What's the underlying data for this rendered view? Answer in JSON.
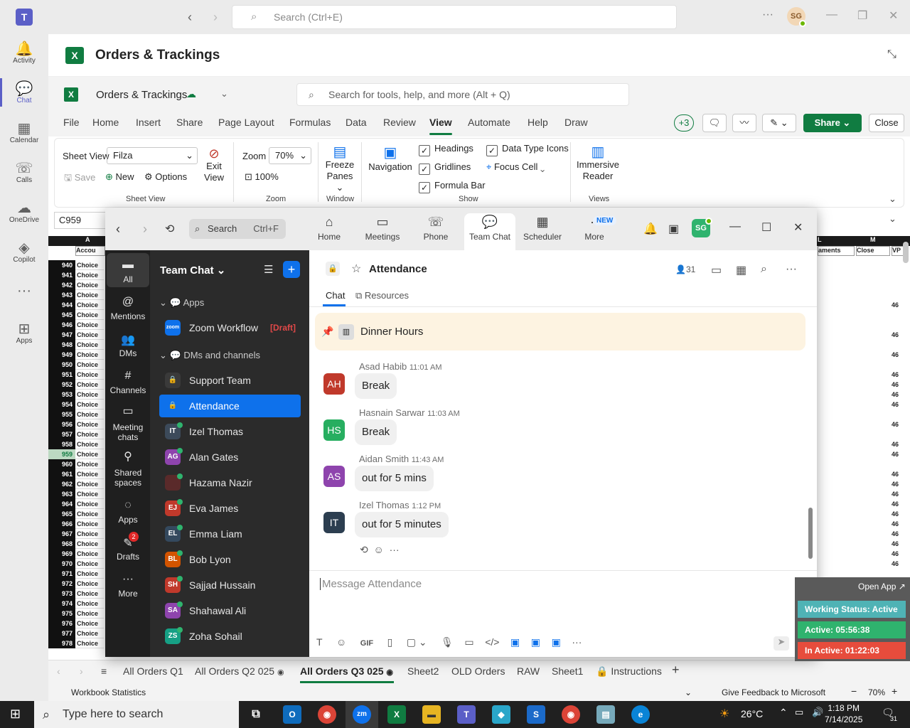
{
  "teams": {
    "search_placeholder": "Search (Ctrl+E)",
    "user_initials": "SG",
    "rail": [
      {
        "label": "Activity",
        "icon": "bell-icon"
      },
      {
        "label": "Chat",
        "icon": "chat-icon"
      },
      {
        "label": "Calendar",
        "icon": "calendar-icon"
      },
      {
        "label": "Calls",
        "icon": "phone-icon"
      },
      {
        "label": "OneDrive",
        "icon": "cloud-icon"
      },
      {
        "label": "Copilot",
        "icon": "copilot-icon"
      },
      {
        "label": "...",
        "icon": "more-icon"
      },
      {
        "label": "Apps",
        "icon": "apps-icon"
      }
    ]
  },
  "excel": {
    "header_title": "Orders & Trackings",
    "doc_name": "Orders & Trackings",
    "search_placeholder": "Search for tools, help, and more (Alt + Q)",
    "menus": [
      "File",
      "Home",
      "Insert",
      "Share",
      "Page Layout",
      "Formulas",
      "Data",
      "Review",
      "View",
      "Automate",
      "Help",
      "Draw"
    ],
    "active_menu": "View",
    "plus_count": "+3",
    "share_label": "Share",
    "close_label": "Close",
    "ribbon": {
      "sheet_view_label": "Sheet View",
      "sheet_view_value": "Filza",
      "save": "Save",
      "new": "New",
      "options": "Options",
      "exit_view": "Exit",
      "exit_view2": "View",
      "group_sheet_view": "Sheet View",
      "zoom_label": "Zoom",
      "zoom_value": "70%",
      "zoom_100": "100%",
      "group_zoom": "Zoom",
      "freeze1": "Freeze",
      "freeze2": "Panes",
      "group_window": "Window",
      "navigation": "Navigation",
      "headings": "Headings",
      "gridlines": "Gridlines",
      "formula_bar": "Formula Bar",
      "data_type_icons": "Data Type Icons",
      "focus_cell": "Focus Cell",
      "group_show": "Show",
      "immersive1": "Immersive",
      "immersive2": "Reader",
      "group_views": "Views"
    },
    "name_box": "C959",
    "col_a": "A",
    "col_l": "L",
    "col_m": "M",
    "hdr_a": "Accou",
    "hdr_l": "aments",
    "hdr_m": "Close",
    "hdr_n": "VP",
    "row_cell": "Choice",
    "rows": [
      "940",
      "941",
      "942",
      "943",
      "944",
      "945",
      "946",
      "947",
      "948",
      "949",
      "950",
      "951",
      "952",
      "953",
      "954",
      "955",
      "956",
      "957",
      "958",
      "959",
      "960",
      "961",
      "962",
      "963",
      "964",
      "965",
      "966",
      "967",
      "968",
      "969",
      "970",
      "971",
      "972",
      "973",
      "974",
      "975",
      "976",
      "977",
      "978"
    ],
    "right_val": "46",
    "sheet_tabs": [
      "All Orders Q1",
      "All Orders Q2 025",
      "All Orders Q3 025",
      "Sheet2",
      "OLD Orders",
      "RAW",
      "Sheet1",
      "Instructions"
    ],
    "status_left": "Workbook Statistics",
    "status_feedback": "Give Feedback to Microsoft",
    "status_zoom": "70%"
  },
  "zoom": {
    "search": "Search",
    "search_key": "Ctrl+F",
    "nav": [
      "Home",
      "Meetings",
      "Phone",
      "Team Chat",
      "Scheduler",
      "More"
    ],
    "new_badge": "NEW",
    "avatar": "SG",
    "rail": [
      "All",
      "Mentions",
      "DMs",
      "Channels",
      "Meeting",
      "chats",
      "Shared",
      "spaces",
      "Apps",
      "Drafts",
      "More"
    ],
    "drafts_count": "2",
    "sidebar_title": "Team Chat",
    "section_apps": "Apps",
    "zoom_workflow": "Zoom Workflow",
    "draft_tag": "[Draft]",
    "section_dms": "DMs and channels",
    "contacts": [
      {
        "name": "Support Team",
        "initials": "",
        "color": "#3a3a3a",
        "lock": true
      },
      {
        "name": "Attendance",
        "initials": "",
        "color": "#0e71eb",
        "lock": true
      },
      {
        "name": "Izel Thomas",
        "initials": "IT",
        "color": "#3c4a5a"
      },
      {
        "name": "Alan Gates",
        "initials": "AG",
        "color": "#8e44ad"
      },
      {
        "name": "Hazama Nazir",
        "initials": "",
        "color": "#5a2a2a"
      },
      {
        "name": "Eva James",
        "initials": "EJ",
        "color": "#c0392b"
      },
      {
        "name": "Emma Liam",
        "initials": "EL",
        "color": "#34495e"
      },
      {
        "name": "Bob Lyon",
        "initials": "BL",
        "color": "#d35400"
      },
      {
        "name": "Sajjad Hussain",
        "initials": "SH",
        "color": "#c0392b"
      },
      {
        "name": "Shahawal Ali",
        "initials": "SA",
        "color": "#8e44ad"
      },
      {
        "name": "Zoha Sohail",
        "initials": "ZS",
        "color": "#16a085"
      }
    ],
    "channel_title": "Attendance",
    "member_count": "31",
    "tab_chat": "Chat",
    "tab_resources": "Resources",
    "pinned": "Dinner Hours",
    "messages": [
      {
        "sender": "Asad Habib",
        "time": "11:01 AM",
        "text": "Break",
        "initials": "AH",
        "color": "#c0392b"
      },
      {
        "sender": "Hasnain Sarwar",
        "time": "11:03 AM",
        "text": "Break",
        "initials": "HS",
        "color": "#27ae60"
      },
      {
        "sender": "Aidan Smith",
        "time": "11:43 AM",
        "text": "out for 5 mins",
        "initials": "AS",
        "color": "#8e44ad"
      },
      {
        "sender": "Izel Thomas",
        "time": "1:12 PM",
        "text": "out for 5 minutes",
        "initials": "IT",
        "color": "#2c3e50"
      }
    ],
    "composer_placeholder": "Message Attendance",
    "gif": "GIF"
  },
  "widget": {
    "open_app": "Open App ↗",
    "working_status": "Working Status: Active",
    "active": "Active: 05:56:38",
    "inactive": "In Active: 01:22:03",
    "colors": {
      "status": "#4fb3b5",
      "active": "#2fb36e",
      "inactive": "#e74c3c"
    }
  },
  "taskbar": {
    "search_placeholder": "Type here to search",
    "weather": "26°C",
    "time": "1:18 PM",
    "date": "7/14/2025",
    "notif_count": "31"
  }
}
